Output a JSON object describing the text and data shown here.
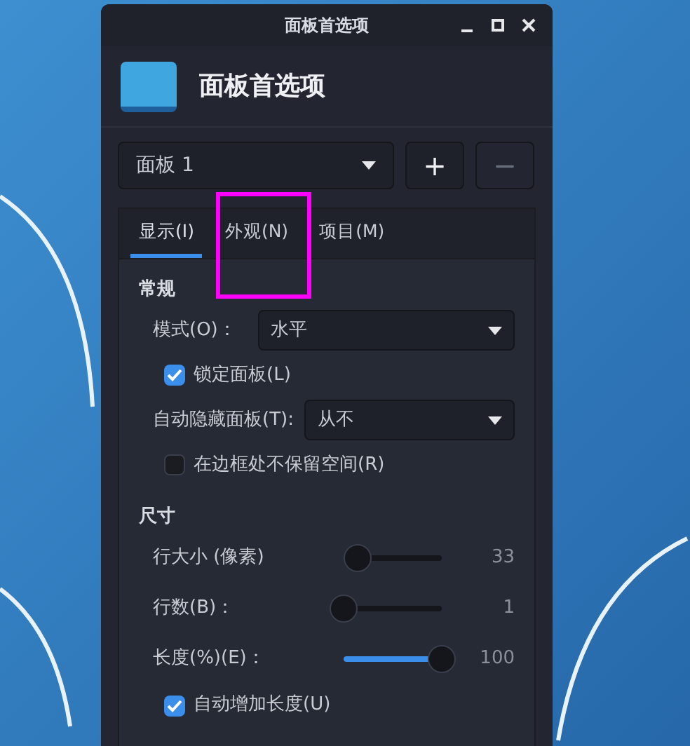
{
  "window": {
    "title": "面板首选项"
  },
  "header": {
    "title": "面板首选项"
  },
  "panel_selector": {
    "value": "面板 1",
    "add_label": "+",
    "remove_label": "−",
    "remove_disabled": true
  },
  "tabs": [
    {
      "label": "显示(I)",
      "selected": true
    },
    {
      "label": "外观(N)",
      "selected": false
    },
    {
      "label": "项目(M)",
      "selected": false
    }
  ],
  "sections": [
    {
      "title": "常规",
      "rows": [
        {
          "kind": "combo",
          "label": "模式(O)：",
          "value": "水平"
        },
        {
          "kind": "checkbox",
          "label": "锁定面板(L)",
          "checked": true
        },
        {
          "kind": "combo",
          "label": "自动隐藏面板(T):",
          "value": "从不"
        },
        {
          "kind": "checkbox",
          "label": "在边框处不保留空间(R)",
          "checked": false
        }
      ]
    },
    {
      "title": "尺寸",
      "rows": [
        {
          "kind": "slider",
          "label": "行大小 (像素)",
          "level": 0.14,
          "reading": "33"
        },
        {
          "kind": "slider",
          "label": "行数(B)：",
          "level": 0,
          "reading": "1"
        },
        {
          "kind": "slider",
          "label": "长度(%)(E)：",
          "level": 1,
          "reading": "100"
        },
        {
          "kind": "checkbox",
          "label": "自动增加长度(U)",
          "checked": true
        }
      ]
    }
  ]
}
